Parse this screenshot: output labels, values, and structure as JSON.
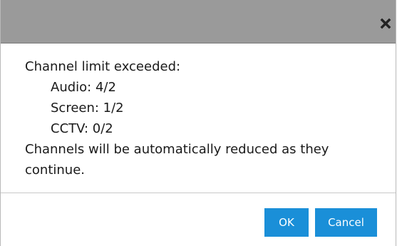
{
  "dialog": {
    "close_icon": "close-x-icon",
    "message": {
      "heading": "Channel limit exceeded:",
      "items": [
        "Audio: 4/2",
        "Screen: 1/2",
        "CCTV: 0/2"
      ],
      "footer_line1": "Channels will be automatically reduced as they",
      "footer_line2": "continue."
    },
    "buttons": {
      "ok_label": "OK",
      "cancel_label": "Cancel"
    }
  },
  "colors": {
    "titlebar": "#9a9a9a",
    "button": "#1a8fd8",
    "text": "#1a1a1a"
  }
}
